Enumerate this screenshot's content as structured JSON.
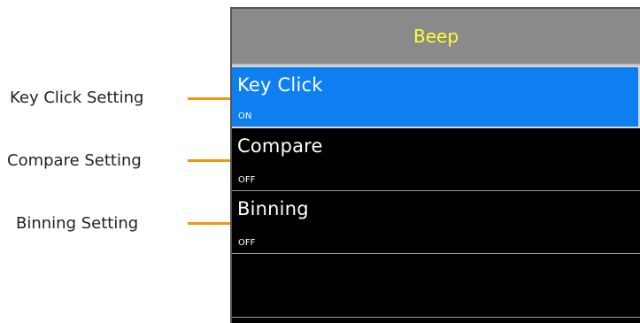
{
  "menu": {
    "title": "Beep",
    "items": [
      {
        "label": "Key Click",
        "value": "ON",
        "selected": true
      },
      {
        "label": "Compare",
        "value": "OFF",
        "selected": false
      },
      {
        "label": "Binning",
        "value": "OFF",
        "selected": false
      }
    ]
  },
  "callouts": [
    {
      "label": "Key Click Setting"
    },
    {
      "label": "Compare Setting"
    },
    {
      "label": "Binning Setting"
    }
  ],
  "colors": {
    "title_text": "#ffff33",
    "title_bar": "#8a8a8a",
    "selected_item": "#0d7ff0",
    "callout_line": "#f0960f",
    "screen_background": "#000000"
  }
}
